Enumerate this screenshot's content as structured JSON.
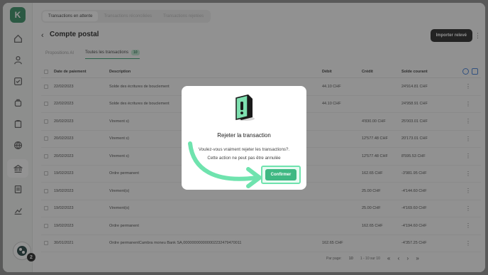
{
  "colors": {
    "accent": "#3fb883",
    "highlight": "#6fe3ae",
    "brand": "#2f8a5e",
    "dark_button": "#1e1e1e"
  },
  "app": {
    "logo_text": "K",
    "avatar_badge": "2"
  },
  "sidebar": {
    "icons": [
      "home-icon",
      "user-icon",
      "check-square-icon",
      "bag-icon",
      "clipboard-icon",
      "globe-icon",
      "bank-icon",
      "receipt-icon",
      "chart-icon"
    ]
  },
  "header": {
    "tabs": [
      "Transactions en attente",
      "Transactions réconciliées",
      "Transactions rejetées"
    ],
    "back_symbol": "‹",
    "title": "Compte postal",
    "import_button": "Importer relevé",
    "kebab": "⋮"
  },
  "subtabs": [
    {
      "label": "Propositions AI"
    },
    {
      "label": "Toutes les transactions",
      "count": "10"
    }
  ],
  "table": {
    "headers": {
      "date": "Date de paiement",
      "description": "Description",
      "debit": "Débit",
      "credit": "Crédit",
      "balance": "Solde courant"
    },
    "rows": [
      {
        "date": "22/02/2023",
        "description": "Solde des écritures de bouclement",
        "debit": "44.10 CHF",
        "credit": "",
        "balance": "24'914.81 CHF"
      },
      {
        "date": "22/02/2023",
        "description": "Solde des écritures de bouclement",
        "debit": "44.10 CHF",
        "credit": "",
        "balance": "24'958.91 CHF"
      },
      {
        "date": "20/02/2023",
        "description": "Virement s)",
        "debit": "",
        "credit": "4'830.00 CHF",
        "balance": "25'003.01 CHF"
      },
      {
        "date": "20/02/2023",
        "description": "Virement s)",
        "debit": "",
        "credit": "12'577.48 CHF",
        "balance": "20'173.01 CHF"
      },
      {
        "date": "20/02/2023",
        "description": "Virement s)",
        "debit": "",
        "credit": "12'577.48 CHF",
        "balance": "8'595.53 CHF"
      },
      {
        "date": "19/02/2023",
        "description": "Ordre permanent",
        "debit": "",
        "credit": "162.65 CHF",
        "balance": "-3'981.95 CHF"
      },
      {
        "date": "19/02/2023",
        "description": "Virement(s)",
        "debit": "",
        "credit": "25.00 CHF",
        "balance": "-4'144.60 CHF"
      },
      {
        "date": "19/02/2023",
        "description": "Virement(s)",
        "debit": "",
        "credit": "25.00 CHF",
        "balance": "-4'169.60 CHF"
      },
      {
        "date": "19/02/2023",
        "description": "Ordre permanent",
        "debit": "",
        "credit": "162.65 CHF",
        "balance": "-4'194.60 CHF"
      },
      {
        "date": "30/01/2021",
        "description": "Ordre permanentCambra moneu Bank SA,000000000000002232479470011",
        "debit": "162.65 CHF",
        "credit": "",
        "balance": "-4'357.25 CHF"
      }
    ]
  },
  "pager": {
    "label": "Par page:",
    "per_page": "10",
    "range": "1 - 10 sur 10",
    "arrows": "« ‹ › »"
  },
  "modal": {
    "title": "Rejeter la transaction",
    "line1": "Voulez-vous vraiment rejeter les transactions?.",
    "line2": "Cette action ne peut pas être annulée",
    "confirm": "Confirmer"
  }
}
